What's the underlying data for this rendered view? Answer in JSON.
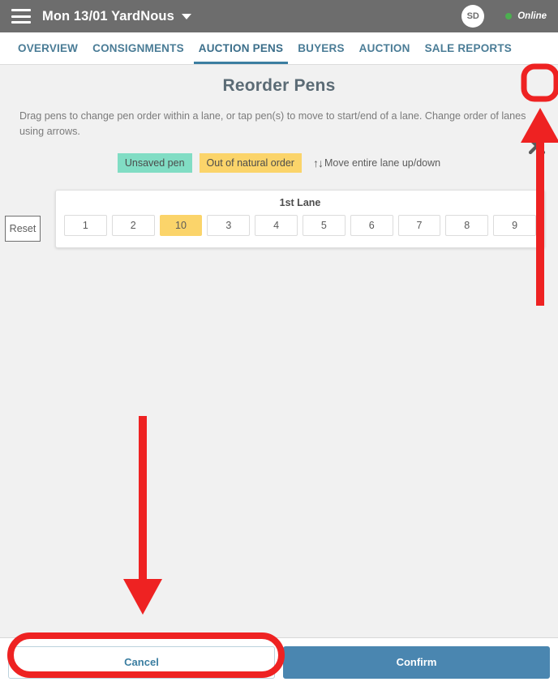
{
  "topbar": {
    "menu_icon": "hamburger-icon",
    "title": "Mon 13/01 YardNous",
    "caret_icon": "chevron-down-icon",
    "avatar_initials": "SD",
    "status_label": "Online",
    "status_color": "#4caf50"
  },
  "tabs": [
    {
      "label": "OVERVIEW",
      "active": false
    },
    {
      "label": "CONSIGNMENTS",
      "active": false
    },
    {
      "label": "AUCTION PENS",
      "active": true
    },
    {
      "label": "BUYERS",
      "active": false
    },
    {
      "label": "AUCTION",
      "active": false
    },
    {
      "label": "SALE REPORTS",
      "active": false
    }
  ],
  "modal": {
    "title": "Reorder Pens",
    "close_icon": "close-icon",
    "instructions": "Drag pens to change pen order within a lane, or tap pen(s) to move to start/end of a lane. Change order of lanes using arrows.",
    "legend": {
      "unsaved_label": "Unsaved pen",
      "unsaved_color": "#81ddc4",
      "natural_label": "Out of natural order",
      "natural_color": "#fbd46a",
      "move_glyphs": "↑↓",
      "move_label": "Move entire lane up/down"
    },
    "reset_label": "Reset",
    "lanes": [
      {
        "title": "1st Lane",
        "pens": [
          {
            "label": "1",
            "state": "normal"
          },
          {
            "label": "2",
            "state": "normal"
          },
          {
            "label": "10",
            "state": "out-of-order"
          },
          {
            "label": "3",
            "state": "normal"
          },
          {
            "label": "4",
            "state": "normal"
          },
          {
            "label": "5",
            "state": "normal"
          },
          {
            "label": "6",
            "state": "normal"
          },
          {
            "label": "7",
            "state": "normal"
          },
          {
            "label": "8",
            "state": "normal"
          },
          {
            "label": "9",
            "state": "normal"
          }
        ]
      }
    ]
  },
  "footer": {
    "cancel_label": "Cancel",
    "confirm_label": "Confirm",
    "confirm_color": "#4a86b0"
  },
  "annotations": {
    "color": "#ee2222",
    "close_highlight": "red-rounded-rect-around-close-icon",
    "arrow_up": "red-arrow-pointing-to-close-icon",
    "arrow_down": "red-arrow-pointing-to-cancel-button",
    "cancel_highlight": "red-rounded-rect-around-cancel-button"
  }
}
